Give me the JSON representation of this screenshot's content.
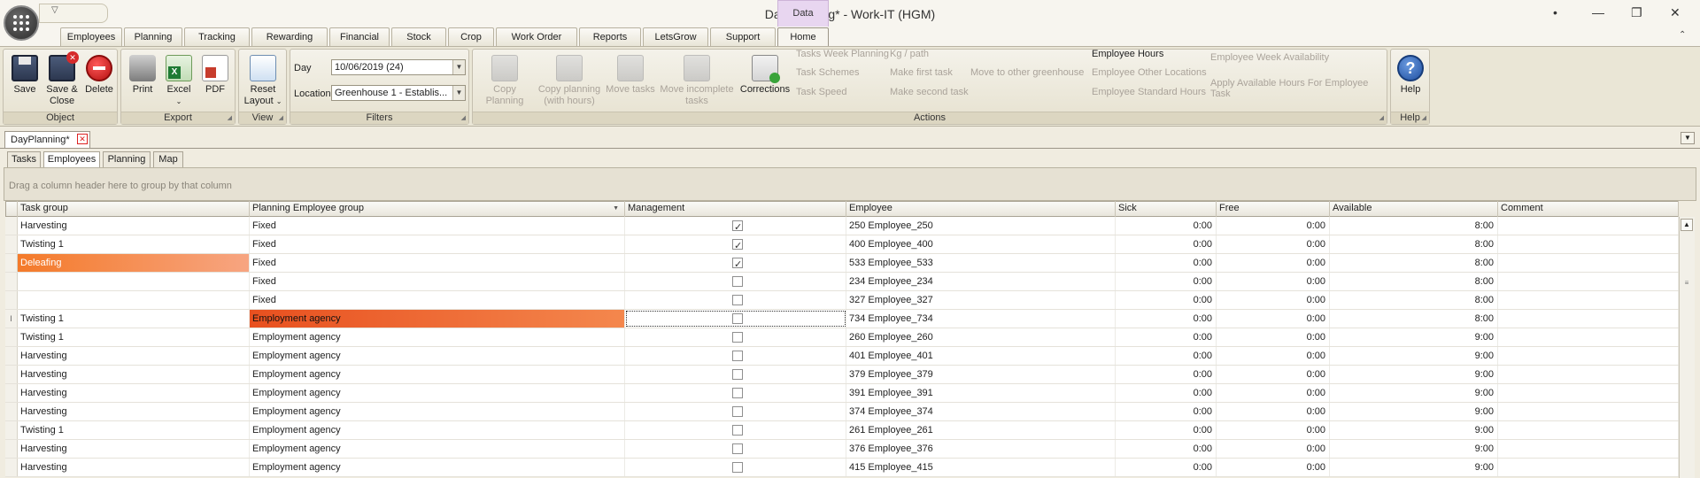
{
  "window": {
    "title": "DayPlanning* - Work-IT (HGM)",
    "context_tab": "Data",
    "controls": [
      "•",
      "—",
      "❐",
      "✕"
    ]
  },
  "ribbon_tabs": [
    "Employees",
    "Planning",
    "Tracking",
    "Rewarding",
    "Financial",
    "Stock",
    "Crop",
    "Work Order",
    "Reports",
    "LetsGrow",
    "Support",
    "Home"
  ],
  "active_ribbon_tab": "Home",
  "groups": {
    "object": {
      "label": "Object",
      "save": "Save",
      "save_close_1": "Save &",
      "save_close_2": "Close",
      "delete": "Delete"
    },
    "export": {
      "label": "Export",
      "print": "Print",
      "excel": "Excel",
      "pdf": "PDF"
    },
    "view": {
      "label": "View",
      "reset_1": "Reset",
      "reset_2": "Layout"
    },
    "filters": {
      "label": "Filters",
      "day_label": "Day",
      "day_value": "10/06/2019 (24)",
      "location_label": "Location",
      "location_value": "Greenhouse 1 - Establis..."
    },
    "actions": {
      "label": "Actions",
      "copy_planning": "Copy Planning",
      "copy_planning_hours_1": "Copy planning",
      "copy_planning_hours_2": "(with hours)",
      "move_tasks": "Move tasks",
      "move_incomplete_1": "Move incomplete",
      "move_incomplete_2": "tasks",
      "corrections": "Corrections",
      "tasks_week_planning": "Tasks Week Planning",
      "task_schemes": "Task Schemes",
      "task_speed": "Task Speed",
      "kg_path": "Kg / path",
      "make_first_task": "Make first task",
      "make_second_task": "Make second task",
      "move_other_greenhouse": "Move to other greenhouse",
      "employee_hours": "Employee Hours",
      "employee_other_locations": "Employee Other Locations",
      "employee_standard_hours": "Employee Standard Hours",
      "employee_week_availability": "Employee Week Availability",
      "apply_available_hours": "Apply Available Hours For Employee Task"
    },
    "help": {
      "label": "Help",
      "help": "Help"
    }
  },
  "document_tab": "DayPlanning*",
  "sub_tabs": [
    "Tasks",
    "Employees",
    "Planning",
    "Map"
  ],
  "active_sub_tab": "Employees",
  "group_hint": "Drag a column header here to group by that column",
  "columns": [
    "Task group",
    "Planning Employee group",
    "Management",
    "Employee",
    "Sick",
    "Free",
    "Available",
    "Comment"
  ],
  "rows": [
    {
      "task_group": "Harvesting",
      "emp_group": "Fixed",
      "management": true,
      "employee": "250 Employee_250",
      "sick": "0:00",
      "free": "0:00",
      "available": "8:00",
      "comment": ""
    },
    {
      "task_group": "Twisting 1",
      "emp_group": "Fixed",
      "management": true,
      "employee": "400 Employee_400",
      "sick": "0:00",
      "free": "0:00",
      "available": "8:00",
      "comment": ""
    },
    {
      "task_group": "Deleafing",
      "emp_group": "Fixed",
      "management": true,
      "employee": "533 Employee_533",
      "sick": "0:00",
      "free": "0:00",
      "available": "8:00",
      "comment": ""
    },
    {
      "task_group": "",
      "emp_group": "Fixed",
      "management": false,
      "employee": "234 Employee_234",
      "sick": "0:00",
      "free": "0:00",
      "available": "8:00",
      "comment": ""
    },
    {
      "task_group": "",
      "emp_group": "Fixed",
      "management": false,
      "employee": "327 Employee_327",
      "sick": "0:00",
      "free": "0:00",
      "available": "8:00",
      "comment": ""
    },
    {
      "task_group": "Twisting 1",
      "emp_group": "Employment agency",
      "management": false,
      "employee": "734 Employee_734",
      "sick": "0:00",
      "free": "0:00",
      "available": "8:00",
      "comment": ""
    },
    {
      "task_group": "Twisting 1",
      "emp_group": "Employment agency",
      "management": false,
      "employee": "260 Employee_260",
      "sick": "0:00",
      "free": "0:00",
      "available": "9:00",
      "comment": ""
    },
    {
      "task_group": "Harvesting",
      "emp_group": "Employment agency",
      "management": false,
      "employee": "401 Employee_401",
      "sick": "0:00",
      "free": "0:00",
      "available": "9:00",
      "comment": ""
    },
    {
      "task_group": "Harvesting",
      "emp_group": "Employment agency",
      "management": false,
      "employee": "379 Employee_379",
      "sick": "0:00",
      "free": "0:00",
      "available": "9:00",
      "comment": ""
    },
    {
      "task_group": "Harvesting",
      "emp_group": "Employment agency",
      "management": false,
      "employee": "391 Employee_391",
      "sick": "0:00",
      "free": "0:00",
      "available": "9:00",
      "comment": ""
    },
    {
      "task_group": "Harvesting",
      "emp_group": "Employment agency",
      "management": false,
      "employee": "374 Employee_374",
      "sick": "0:00",
      "free": "0:00",
      "available": "9:00",
      "comment": ""
    },
    {
      "task_group": "Twisting 1",
      "emp_group": "Employment agency",
      "management": false,
      "employee": "261 Employee_261",
      "sick": "0:00",
      "free": "0:00",
      "available": "9:00",
      "comment": ""
    },
    {
      "task_group": "Harvesting",
      "emp_group": "Employment agency",
      "management": false,
      "employee": "376 Employee_376",
      "sick": "0:00",
      "free": "0:00",
      "available": "9:00",
      "comment": ""
    },
    {
      "task_group": "Harvesting",
      "emp_group": "Employment agency",
      "management": false,
      "employee": "415 Employee_415",
      "sick": "0:00",
      "free": "0:00",
      "available": "9:00",
      "comment": ""
    }
  ],
  "colors": {
    "highlight_orange": "#f47a2a",
    "highlight_red": "#e8501f",
    "ribbon_bg": "#eae6d6",
    "context_tab": "#e8d6f0"
  }
}
